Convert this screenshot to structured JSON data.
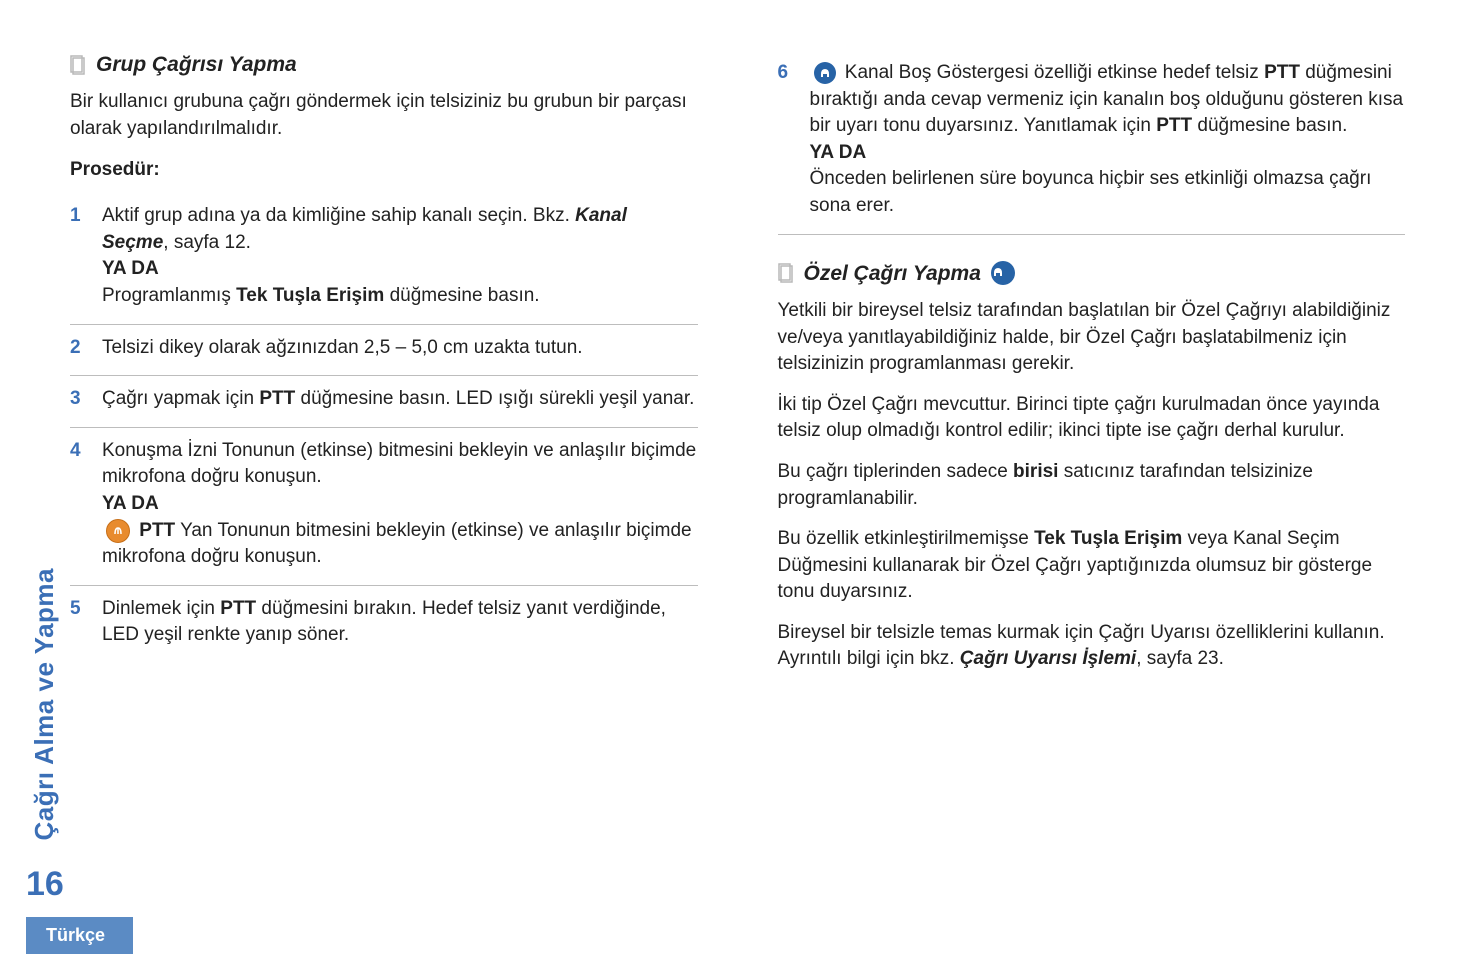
{
  "sidebar": {
    "vertical_label": "Çağrı Alma ve Yapma",
    "page_number": "16"
  },
  "footer": {
    "language": "Türkçe"
  },
  "left": {
    "heading": "Grup Çağrısı Yapma",
    "intro": "Bir kullanıcı grubuna çağrı göndermek için telsiziniz bu grubun bir parçası olarak yapılandırılmalıdır.",
    "procedure_label": "Prosedür:",
    "steps": {
      "s1": {
        "num": "1",
        "line1": "Aktif grup adına ya da kimliğine sahip kanalı seçin. Bkz. ",
        "link": "Kanal Seçme",
        "page_ref": ", sayfa 12.",
        "or": "YA DA",
        "line2_pre": "Programlanmış ",
        "line2_bold": "Tek Tuşla Erişim",
        "line2_post": " düğmesine basın."
      },
      "s2": {
        "num": "2",
        "text": "Telsizi dikey olarak ağzınızdan 2,5 – 5,0 cm uzakta tutun."
      },
      "s3": {
        "num": "3",
        "pre": "Çağrı yapmak için ",
        "bold": "PTT",
        "post": " düğmesine basın. LED ışığı sürekli yeşil yanar."
      },
      "s4": {
        "num": "4",
        "line1": "Konuşma İzni Tonunun (etkinse) bitmesini bekleyin ve anlaşılır biçimde mikrofona doğru konuşun.",
        "or": "YA DA",
        "bold": "PTT",
        "line2": " Yan Tonunun bitmesini bekleyin (etkinse) ve anlaşılır biçimde mikrofona doğru konuşun."
      },
      "s5": {
        "num": "5",
        "pre": "Dinlemek için ",
        "bold": "PTT",
        "post": " düğmesini bırakın. Hedef telsiz yanıt verdiğinde, LED yeşil renkte yanıp söner."
      }
    }
  },
  "right": {
    "step6": {
      "num": "6",
      "seg1": " Kanal Boş Göstergesi özelliği etkinse hedef telsiz ",
      "bold1": "PTT",
      "seg2": " düğmesini bıraktığı anda cevap vermeniz için kanalın boş olduğunu gösteren kısa bir uyarı tonu duyarsınız. Yanıtlamak için ",
      "bold2": "PTT",
      "seg3": " düğmesine basın.",
      "or": "YA DA",
      "seg4": "Önceden belirlenen süre boyunca hiçbir ses etkinliği olmazsa çağrı sona erer."
    },
    "heading": "Özel Çağrı Yapma",
    "p1": "Yetkili bir bireysel telsiz tarafından başlatılan bir Özel Çağrıyı alabildiğiniz ve/veya yanıtlayabildiğiniz halde, bir Özel Çağrı başlatabilmeniz için telsizinizin programlanması gerekir.",
    "p2": "İki tip Özel Çağrı mevcuttur. Birinci tipte çağrı kurulmadan önce yayında telsiz olup olmadığı kontrol edilir; ikinci tipte ise çağrı derhal kurulur.",
    "p3_pre": "Bu çağrı tiplerinden sadece ",
    "p3_bold": "birisi",
    "p3_post": " satıcınız tarafından telsizinize programlanabilir.",
    "p4_pre": "Bu özellik etkinleştirilmemişse ",
    "p4_bold": "Tek Tuşla Erişim",
    "p4_post": " veya Kanal Seçim Düğmesini kullanarak bir Özel Çağrı yaptığınızda olumsuz bir gösterge tonu duyarsınız.",
    "p5_pre": "Bireysel bir telsizle temas kurmak için Çağrı Uyarısı özelliklerini kullanın. Ayrıntılı bilgi için bkz. ",
    "p5_link": "Çağrı Uyarısı İşlemi",
    "p5_post": ", sayfa 23."
  }
}
